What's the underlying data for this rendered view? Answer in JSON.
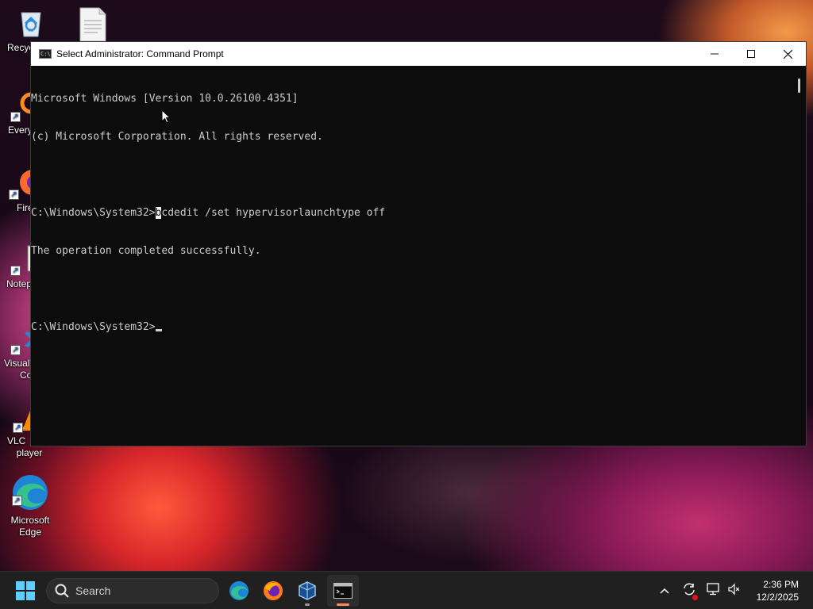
{
  "desktop": {
    "icons": [
      {
        "label": "Recyc"
      },
      {
        "label": ""
      },
      {
        "label": "Every"
      },
      {
        "label": "Fire"
      },
      {
        "label": "Notep"
      },
      {
        "label": "Visual",
        "label2": "Co"
      },
      {
        "label": "VLC",
        "label2": "player"
      },
      {
        "label": "Microsoft",
        "label2": "Edge"
      }
    ]
  },
  "window": {
    "title": "Select Administrator: Command Prompt",
    "icon": "console-icon",
    "controls": [
      "minimize-icon",
      "maximize-icon",
      "close-icon"
    ]
  },
  "console": {
    "lines": [
      "Microsoft Windows [Version 10.0.26100.4351]",
      "(c) Microsoft Corporation. All rights reserved.",
      "",
      "C:\\Windows\\System32>",
      "The operation completed successfully.",
      "",
      "C:\\Windows\\System32>"
    ],
    "selected_char": "b",
    "command_rest": "cdedit /set hypervisorlaunchtype off"
  },
  "taskbar": {
    "search_placeholder": "Search",
    "apps": [
      "start-icon",
      "edge-icon",
      "firefox-icon",
      "virtualbox-icon",
      "terminal-icon"
    ],
    "active_app": "terminal-icon",
    "colors": {
      "accent": "#60cdff",
      "active_indicator": "#ff8c5a"
    }
  },
  "clock": {
    "time": "2:36 PM",
    "date": "12/2/2025"
  }
}
